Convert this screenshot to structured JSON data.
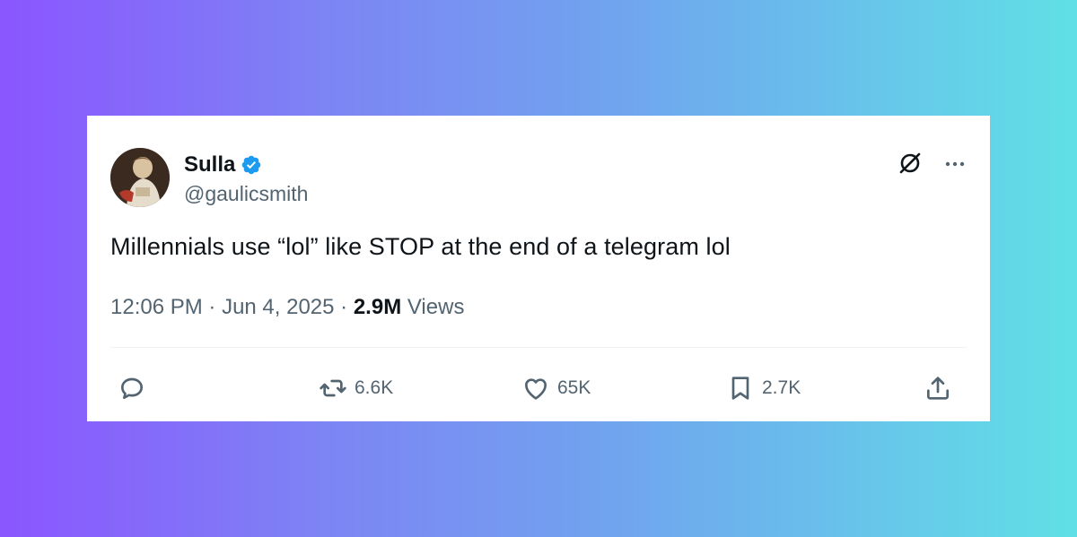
{
  "author": {
    "display_name": "Sulla",
    "handle": "@gaulicsmith",
    "verified": true
  },
  "tweet": {
    "text": "Millennials use “lol” like STOP at the end of a telegram lol",
    "time": "12:06 PM",
    "date": "Jun 4, 2025",
    "views_count": "2.9M",
    "views_label": "Views"
  },
  "actions": {
    "reply_count": "",
    "retweet_count": "6.6K",
    "like_count": "65K",
    "bookmark_count": "2.7K"
  },
  "colors": {
    "verified": "#1d9bf0",
    "text_primary": "#0f1419",
    "text_secondary": "#536471"
  },
  "icons": [
    "grok-icon",
    "more-icon",
    "reply-icon",
    "retweet-icon",
    "like-icon",
    "bookmark-icon",
    "share-icon"
  ]
}
